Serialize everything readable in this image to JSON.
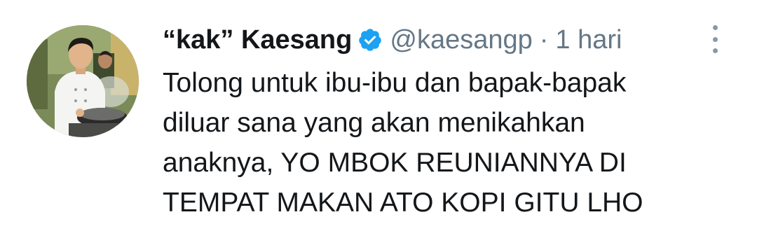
{
  "tweet": {
    "display_name": "“kak” Kaesang",
    "handle": "@kaesangp",
    "separator": "·",
    "time": "1 hari",
    "text_lines": [
      "Tolong untuk ibu-ibu dan bapak-bapak",
      "diluar sana yang akan menikahkan",
      "anaknya, YO MBOK REUNIANNYA DI",
      "TEMPAT MAKAN ATO KOPI GITU LHO"
    ],
    "verified_badge_icon": "verified-check-icon",
    "more_icon": "vertical-ellipsis-icon",
    "colors": {
      "text": "#14171a",
      "secondary": "#657786",
      "verified": "#1da1f2"
    }
  }
}
